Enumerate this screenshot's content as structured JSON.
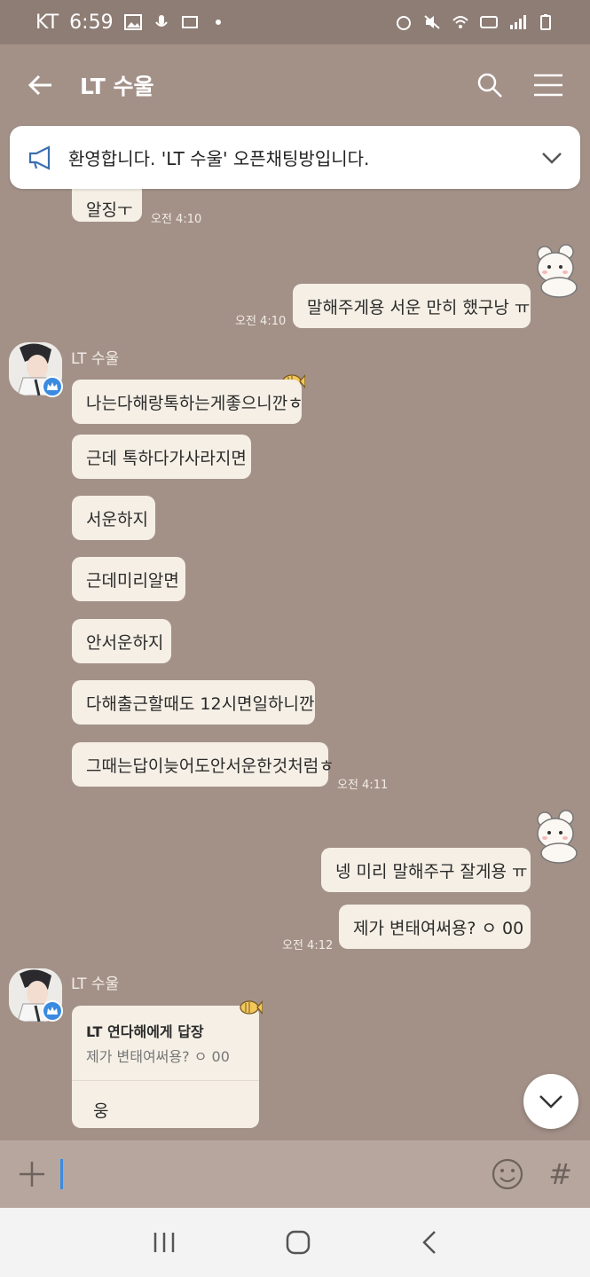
{
  "statusbar": {
    "carrier": "KT",
    "time": "6:59"
  },
  "header": {
    "title": "LT 수울"
  },
  "notice": {
    "text": "환영합니다. 'LT 수울' 오픈채팅방입니다."
  },
  "messages": {
    "partial": {
      "text": "알징ㅜ",
      "time": "오전 4:10"
    },
    "mine1": {
      "text": "말해주게용 서운 만히 했구낭 ㅠ",
      "time": "오전 4:10"
    },
    "sender1": "LT 수울",
    "theirs": [
      {
        "text": "나는다해랑톡하는게좋으니깐ㅎ"
      },
      {
        "text": "근데 톡하다가사라지면"
      },
      {
        "text": "서운하지"
      },
      {
        "text": "근데미리알면"
      },
      {
        "text": "안서운하지"
      },
      {
        "text": "다해출근할때도 12시면일하니깐"
      },
      {
        "text": "그때는답이늦어도안서운한것처럼ㅎ"
      }
    ],
    "theirs_time": "오전 4:11",
    "mine2": [
      {
        "text": "넹 미리 말해주구 잘게용 ㅠ"
      },
      {
        "text": "제가 변태여써용? ㅇ 00"
      }
    ],
    "mine2_time": "오전 4:12",
    "sender2": "LT 수울",
    "reply": {
      "title": "LT 연다해에게 답장",
      "quote": "제가 변태여써용? ㅇ 00",
      "body": "웅"
    }
  },
  "input": {
    "placeholder": ""
  },
  "colors": {
    "background": "#a39188",
    "bubble": "#f5efe5",
    "accent": "#3a8be0"
  }
}
